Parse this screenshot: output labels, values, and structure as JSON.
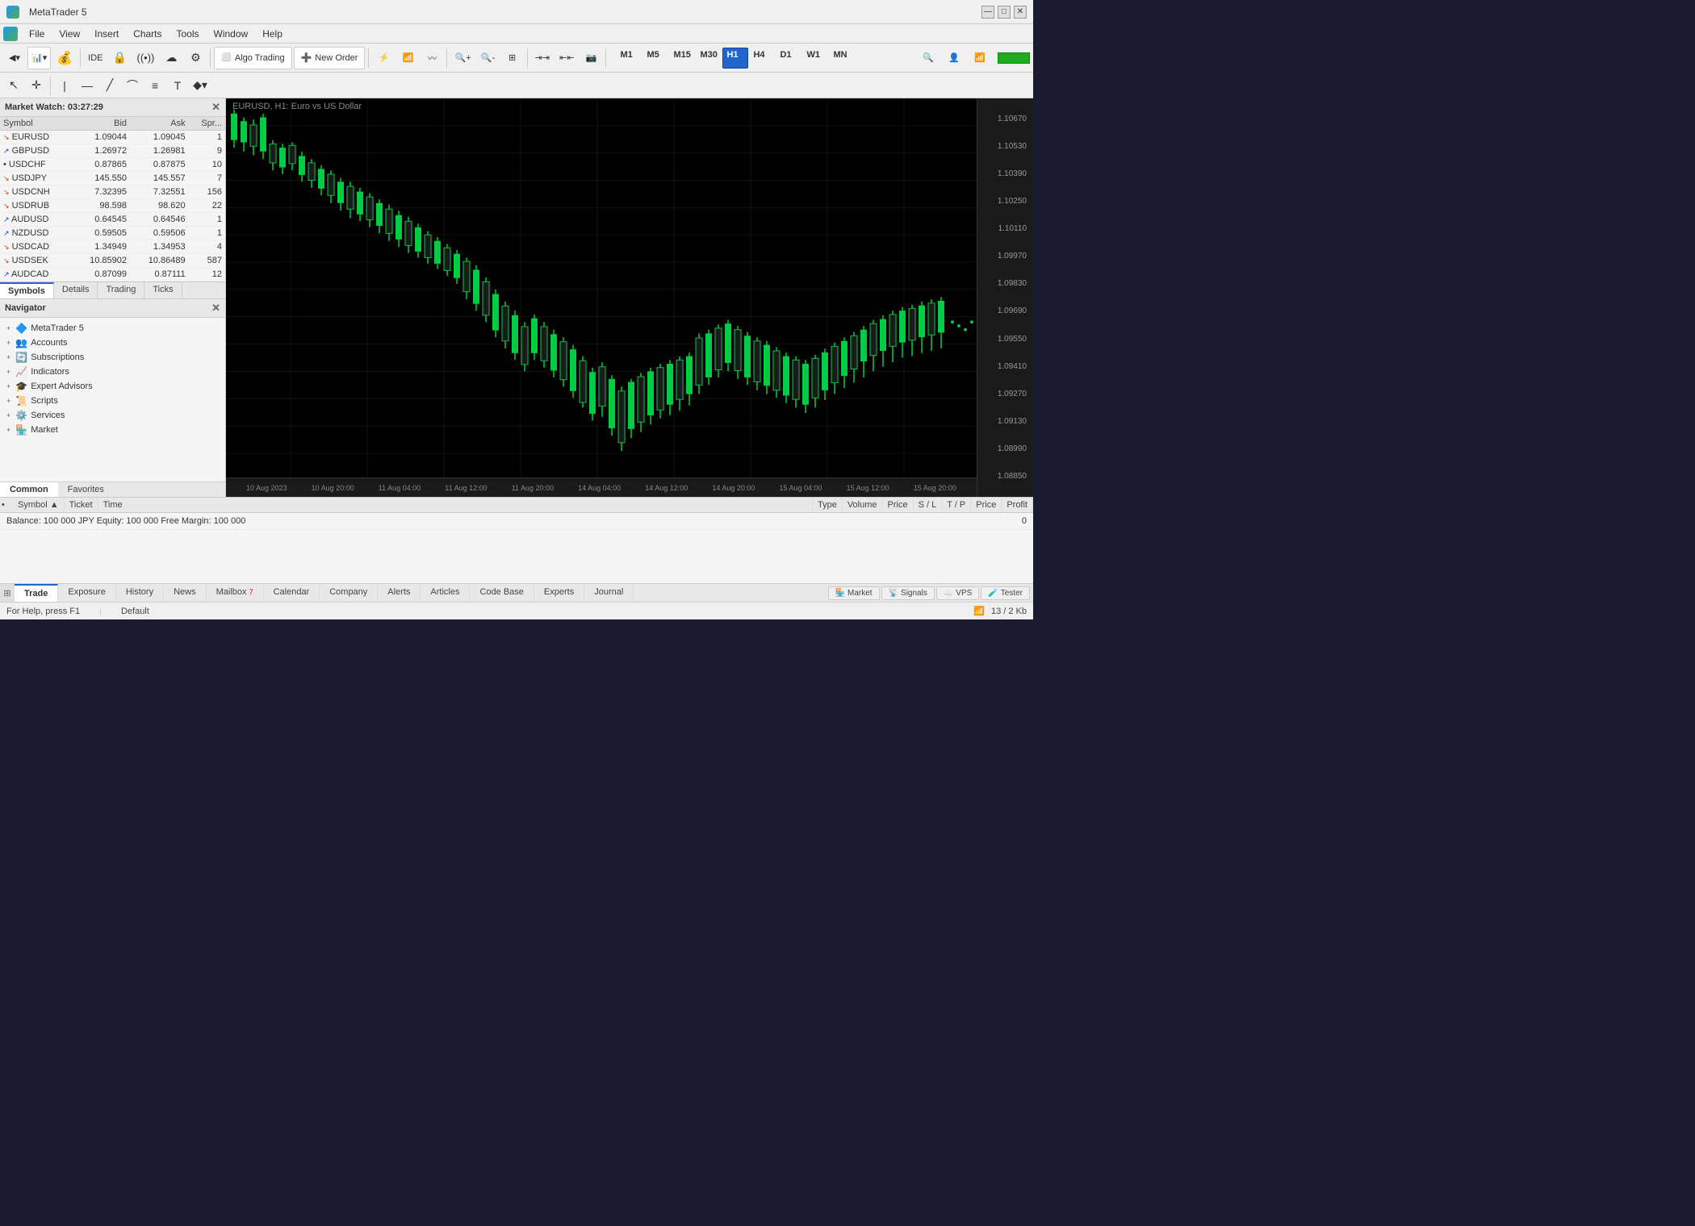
{
  "titlebar": {
    "title": "MetaTrader 5",
    "min_label": "—",
    "max_label": "□",
    "close_label": "✕"
  },
  "menu": {
    "items": [
      {
        "label": "File"
      },
      {
        "label": "View"
      },
      {
        "label": "Insert"
      },
      {
        "label": "Charts"
      },
      {
        "label": "Tools"
      },
      {
        "label": "Window"
      },
      {
        "label": "Help"
      }
    ]
  },
  "toolbar": {
    "algo_trading": "Algo Trading",
    "new_order": "New Order",
    "timeframes": [
      "M1",
      "M5",
      "M15",
      "M30",
      "H1",
      "H4",
      "D1",
      "W1",
      "MN"
    ],
    "active_tf": "H1"
  },
  "market_watch": {
    "title": "Market Watch: 03:27:29",
    "columns": [
      "Symbol",
      "Bid",
      "Ask",
      "Spr..."
    ],
    "symbols": [
      {
        "arrow": "↘",
        "symbol": "EURUSD",
        "bid": "1.09044",
        "ask": "1.09045",
        "spread": "1",
        "bid_class": "price-blue",
        "ask_class": "price-blue"
      },
      {
        "arrow": "↗",
        "symbol": "GBPUSD",
        "bid": "1.26972",
        "ask": "1.26981",
        "spread": "9",
        "bid_class": "price-blue",
        "ask_class": "price-blue"
      },
      {
        "arrow": "•",
        "symbol": "USDCHF",
        "bid": "0.87865",
        "ask": "0.87875",
        "spread": "10",
        "bid_class": "price-red",
        "ask_class": "price-red"
      },
      {
        "arrow": "↘",
        "symbol": "USDJPY",
        "bid": "145.550",
        "ask": "145.557",
        "spread": "7",
        "bid_class": "price-blue",
        "ask_class": "price-blue"
      },
      {
        "arrow": "↘",
        "symbol": "USDCNH",
        "bid": "7.32395",
        "ask": "7.32551",
        "spread": "156",
        "bid_class": "price-blue",
        "ask_class": "price-blue"
      },
      {
        "arrow": "↘",
        "symbol": "USDRUB",
        "bid": "98.598",
        "ask": "98.620",
        "spread": "22",
        "bid_class": "",
        "ask_class": ""
      },
      {
        "arrow": "↗",
        "symbol": "AUDUSD",
        "bid": "0.64545",
        "ask": "0.64546",
        "spread": "1",
        "bid_class": "price-blue",
        "ask_class": "price-blue"
      },
      {
        "arrow": "↗",
        "symbol": "NZDUSD",
        "bid": "0.59505",
        "ask": "0.59506",
        "spread": "1",
        "bid_class": "price-blue",
        "ask_class": "price-blue"
      },
      {
        "arrow": "↘",
        "symbol": "USDCAD",
        "bid": "1.34949",
        "ask": "1.34953",
        "spread": "4",
        "bid_class": "",
        "ask_class": ""
      },
      {
        "arrow": "↘",
        "symbol": "USDSEK",
        "bid": "10.85902",
        "ask": "10.86489",
        "spread": "587",
        "bid_class": "price-blue",
        "ask_class": "price-blue"
      },
      {
        "arrow": "↗",
        "symbol": "AUDCAD",
        "bid": "0.87099",
        "ask": "0.87111",
        "spread": "12",
        "bid_class": "",
        "ask_class": ""
      }
    ],
    "tabs": [
      "Symbols",
      "Details",
      "Trading",
      "Ticks"
    ]
  },
  "navigator": {
    "title": "Navigator",
    "items": [
      {
        "icon": "🔷",
        "label": "MetaTrader 5",
        "expand": "+"
      },
      {
        "icon": "👥",
        "label": "Accounts",
        "expand": "+"
      },
      {
        "icon": "🔄",
        "label": "Subscriptions",
        "expand": "+"
      },
      {
        "icon": "📈",
        "label": "Indicators",
        "expand": "+"
      },
      {
        "icon": "🎓",
        "label": "Expert Advisors",
        "expand": "+"
      },
      {
        "icon": "📜",
        "label": "Scripts",
        "expand": "+"
      },
      {
        "icon": "⚙️",
        "label": "Services",
        "expand": "+"
      },
      {
        "icon": "🏪",
        "label": "Market",
        "expand": "+"
      }
    ],
    "tabs": [
      "Common",
      "Favorites"
    ]
  },
  "chart": {
    "title": "EURUSD, H1:  Euro vs US Dollar",
    "prices": [
      1.1067,
      1.1053,
      1.1039,
      1.1025,
      1.1011,
      1.0997,
      1.0983,
      1.0969,
      1.0955,
      1.0941,
      1.0927,
      1.0913,
      1.0899,
      1.0885
    ],
    "times": [
      "10 Aug 2023",
      "10 Aug 20:00",
      "11 Aug 04:00",
      "11 Aug 12:00",
      "11 Aug 20:00",
      "14 Aug 04:00",
      "14 Aug 12:00",
      "14 Aug 20:00",
      "15 Aug 04:00",
      "15 Aug 12:00",
      "15 Aug 20:00"
    ]
  },
  "trade_panel": {
    "columns": [
      "Symbol",
      "Ticket",
      "Time",
      "Type",
      "Volume",
      "Price",
      "S / L",
      "T / P",
      "Price",
      "Profit"
    ],
    "balance_row": "Balance: 100 000 JPY   Equity: 100 000   Free Margin: 100 000",
    "profit_value": "0",
    "tabs": [
      "Trade",
      "Exposure",
      "History",
      "News",
      "Mailbox",
      "Calendar",
      "Company",
      "Alerts",
      "Articles",
      "Code Base",
      "Experts",
      "Journal"
    ],
    "right_tabs": [
      {
        "icon": "🏪",
        "label": "Market"
      },
      {
        "icon": "📡",
        "label": "Signals"
      },
      {
        "icon": "☁️",
        "label": "VPS"
      },
      {
        "icon": "🧪",
        "label": "Tester"
      }
    ]
  },
  "status_bar": {
    "help_text": "For Help, press F1",
    "profile": "Default",
    "connection": "13 / 2 Kb"
  }
}
